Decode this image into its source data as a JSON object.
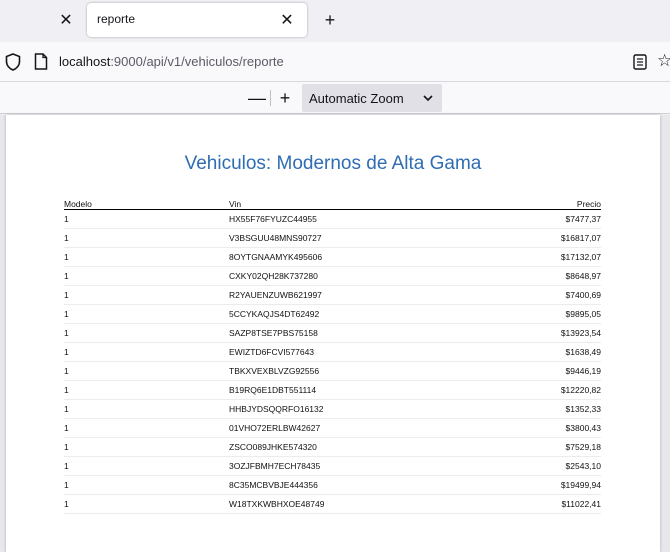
{
  "browser": {
    "tab_title": "reporte",
    "url_host": "localhost",
    "url_rest": ":9000/api/v1/vehiculos/reporte"
  },
  "pdf_toolbar": {
    "zoom_out": "—",
    "zoom_in": "+",
    "zoom_label": "Automatic Zoom"
  },
  "report": {
    "title": "Vehiculos: Modernos de Alta Gama",
    "columns": {
      "modelo": "Modelo",
      "vin": "Vin",
      "precio": "Precio"
    },
    "rows": [
      {
        "modelo": "1",
        "vin": "HX55F76FYUZC44955",
        "precio": "$7477,37"
      },
      {
        "modelo": "1",
        "vin": "V3BSGUU48MNS90727",
        "precio": "$16817,07"
      },
      {
        "modelo": "1",
        "vin": "8OYTGNAAMYK495606",
        "precio": "$17132,07"
      },
      {
        "modelo": "1",
        "vin": "CXKY02QH28K737280",
        "precio": "$8648,97"
      },
      {
        "modelo": "1",
        "vin": "R2YAUENZUWB621997",
        "precio": "$7400,69"
      },
      {
        "modelo": "1",
        "vin": "5CCYKAQJS4DT62492",
        "precio": "$9895,05"
      },
      {
        "modelo": "1",
        "vin": "SAZP8TSE7PBS75158",
        "precio": "$13923,54"
      },
      {
        "modelo": "1",
        "vin": "EWIZTD6FCVI577643",
        "precio": "$1638,49"
      },
      {
        "modelo": "1",
        "vin": "TBKXVEXBLVZG92556",
        "precio": "$9446,19"
      },
      {
        "modelo": "1",
        "vin": "B19RQ6E1DBT551114",
        "precio": "$12220,82"
      },
      {
        "modelo": "1",
        "vin": "HHBJYDSQQRFO16132",
        "precio": "$1352,33"
      },
      {
        "modelo": "1",
        "vin": "01VHO72ERLBW42627",
        "precio": "$3800,43"
      },
      {
        "modelo": "1",
        "vin": "ZSCO089JHKE574320",
        "precio": "$7529,18"
      },
      {
        "modelo": "1",
        "vin": "3OZJFBMH7ECH78435",
        "precio": "$2543,10"
      },
      {
        "modelo": "1",
        "vin": "8C35MCBVBJE444356",
        "precio": "$19499,94"
      },
      {
        "modelo": "1",
        "vin": "W18TXKWBHXOE48749",
        "precio": "$11022,41"
      }
    ]
  }
}
